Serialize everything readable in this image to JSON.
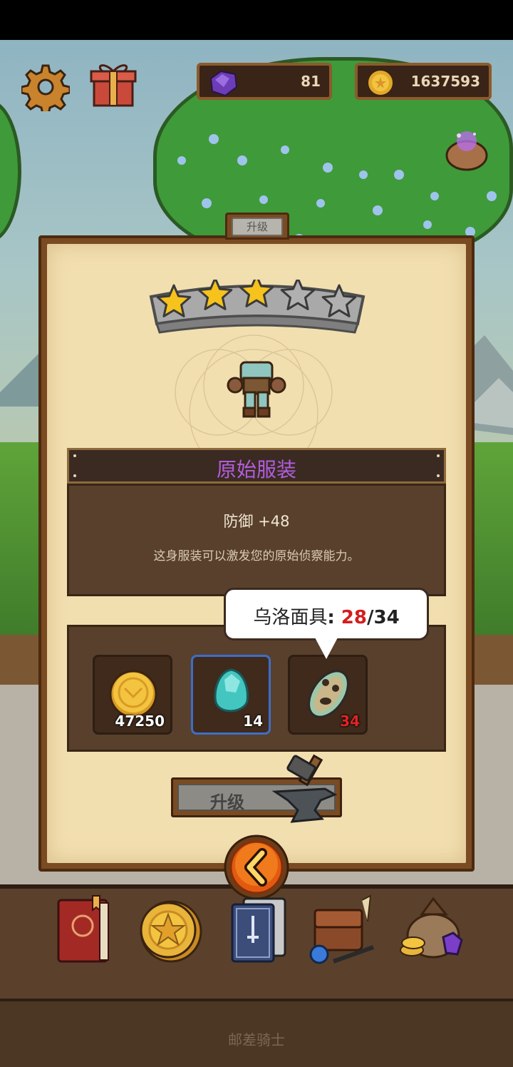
{
  "hud": {
    "gems": "81",
    "coins": "1637593"
  },
  "panel": {
    "tab_label": "升级",
    "stars_filled": 3,
    "stars_total": 5,
    "item_name": "原始服装",
    "item_name_color": "#b25ddd",
    "stat": "防御 +48",
    "description": "这身服装可以激发您的原始侦察能力。"
  },
  "materials": [
    {
      "icon": "gold-coin-icon",
      "count": "47250",
      "selected": false,
      "insufficient": false
    },
    {
      "icon": "crystal-icon",
      "count": "14",
      "selected": true,
      "insufficient": false
    },
    {
      "icon": "mask-icon",
      "count": "34",
      "selected": false,
      "insufficient": true
    }
  ],
  "tooltip": {
    "name": "乌洛面具",
    "separator": ": ",
    "have": "28",
    "need": "34"
  },
  "upgrade_button": {
    "label": "升级"
  },
  "bottom_nav": [
    "book-icon",
    "star-coin-icon",
    "card-deck-icon",
    "satchel-icon",
    "treasure-bag-icon"
  ],
  "footer": {
    "label": "邮差骑士"
  },
  "colors": {
    "panel_parchment": "#f2dfb0",
    "panel_frame": "#7a4b22",
    "box_brown": "#59402c",
    "insufficient_red": "#d41c1c",
    "selected_blue": "#3d6ec8"
  }
}
